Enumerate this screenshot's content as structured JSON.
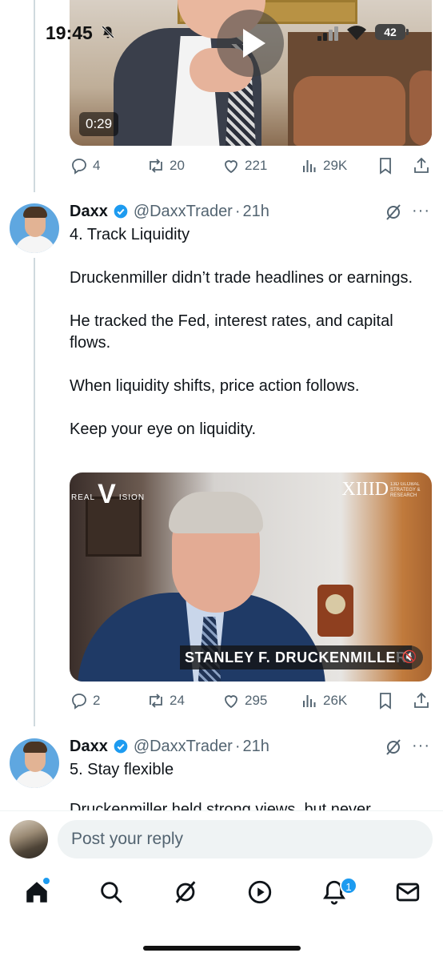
{
  "status_bar": {
    "time": "19:45",
    "battery": "42"
  },
  "top_video": {
    "duration": "0:29"
  },
  "top_actions": {
    "replies": "4",
    "reposts": "20",
    "likes": "221",
    "views": "29K"
  },
  "tweets": [
    {
      "name": "Daxx",
      "handle": "@DaxxTrader",
      "dot": "·",
      "time": "21h",
      "paragraphs": [
        "4. Track Liquidity",
        "",
        "Druckenmiller didn’t trade headlines or earnings.",
        "",
        "He tracked the Fed, interest rates, and capital flows.",
        "",
        "When liquidity shifts, price action follows.",
        "",
        "Keep your eye on liquidity."
      ],
      "media": {
        "logo_left_a": "REAL",
        "logo_left_v": "V",
        "logo_left_b": "ISION",
        "logo_right": "XIIID",
        "logo_right_sub": "13D GLOBAL STRATEGY & RESEARCH",
        "caption": "STANLEY F. DRUCKENMILLER"
      },
      "actions": {
        "replies": "2",
        "reposts": "24",
        "likes": "295",
        "views": "26K"
      }
    },
    {
      "name": "Daxx",
      "handle": "@DaxxTrader",
      "dot": "·",
      "time": "21h",
      "first_line": "5. Stay flexible",
      "cut_line": "Druckenmiller held strong views, but never"
    }
  ],
  "reply_box": {
    "placeholder": "Post your reply"
  },
  "nav": {
    "notifications_badge": "1"
  },
  "colors": {
    "accent": "#1d9bf0",
    "muted": "#536471",
    "text": "#0f1419"
  }
}
